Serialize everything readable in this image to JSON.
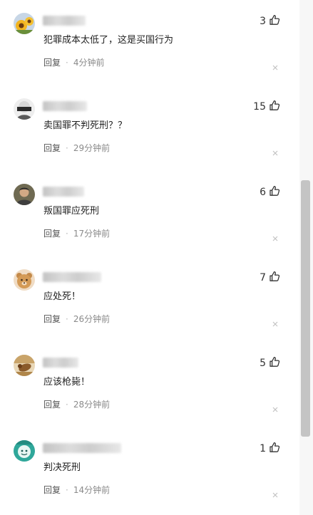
{
  "comments": [
    {
      "text": "犯罪成本太低了，这是买国行为",
      "reply_label": "回复",
      "time": "4分钟前",
      "likes": "3",
      "avatar_icon": "sunflower-avatar-icon"
    },
    {
      "text": "卖国罪不判死刑？？",
      "reply_label": "回复",
      "time": "29分钟前",
      "likes": "15",
      "avatar_icon": "masked-person-avatar-icon"
    },
    {
      "text": "叛国罪应死刑",
      "reply_label": "回复",
      "time": "17分钟前",
      "likes": "6",
      "avatar_icon": "portrait-avatar-icon"
    },
    {
      "text": "应处死！",
      "reply_label": "回复",
      "time": "26分钟前",
      "likes": "7",
      "avatar_icon": "bear-avatar-icon"
    },
    {
      "text": "应该枪毙！",
      "reply_label": "回复",
      "time": "28分钟前",
      "likes": "5",
      "avatar_icon": "bird-avatar-icon"
    },
    {
      "text": "判决死刑",
      "reply_label": "回复",
      "time": "14分钟前",
      "likes": "1",
      "avatar_icon": "teal-cartoon-avatar-icon"
    }
  ],
  "colors": {
    "text": "#222222",
    "meta": "#8a8a8a",
    "scrollbar_thumb": "#c4c4c4"
  }
}
